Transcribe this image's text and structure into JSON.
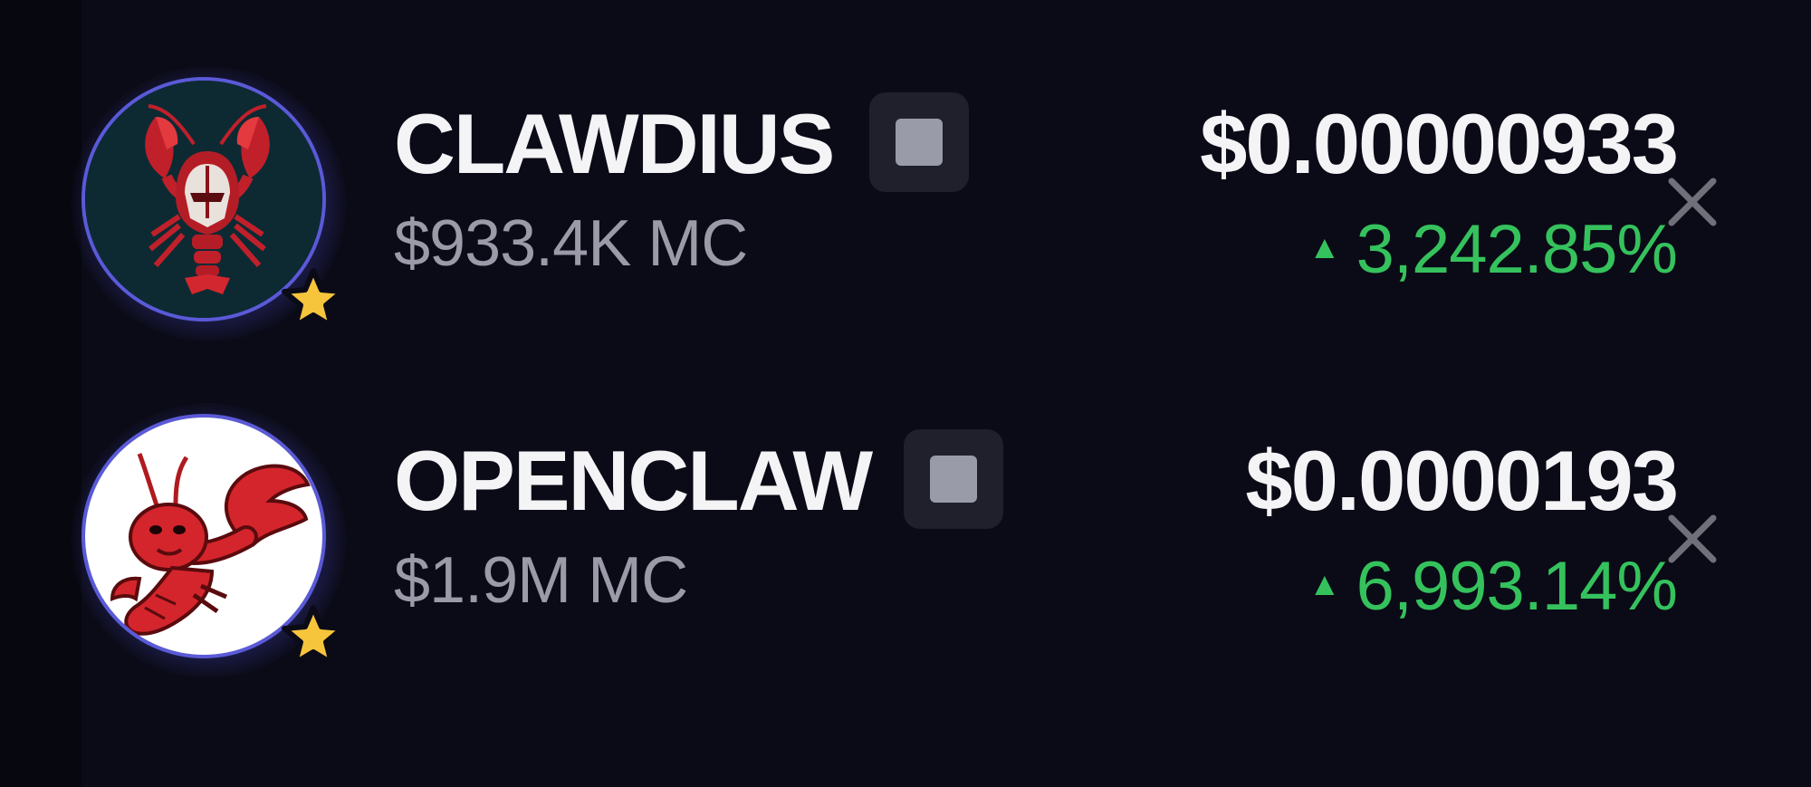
{
  "tokens": [
    {
      "symbol": "CLAWDIUS",
      "price": "$0.00000933",
      "market_cap": "$933.4K MC",
      "change": "3,242.85%",
      "change_arrow": "▲",
      "avatar": "red-armored-lobster-logo",
      "favorite_icon": "star-icon",
      "copy_icon": "copy-square-icon",
      "remove_icon": "close-icon"
    },
    {
      "symbol": "OPENCLAW",
      "price": "$0.0000193",
      "market_cap": "$1.9M MC",
      "change": "6,993.14%",
      "change_arrow": "▲",
      "avatar": "red-cartoon-lobster-logo",
      "favorite_icon": "star-icon",
      "copy_icon": "copy-square-icon",
      "remove_icon": "close-icon"
    }
  ],
  "colors": {
    "background": "#0b0b17",
    "text_primary": "#f4f4f7",
    "text_secondary": "#9a9aa8",
    "positive": "#35c25d",
    "avatar_border": "#5a5ad8",
    "star": "#f7c53b"
  }
}
